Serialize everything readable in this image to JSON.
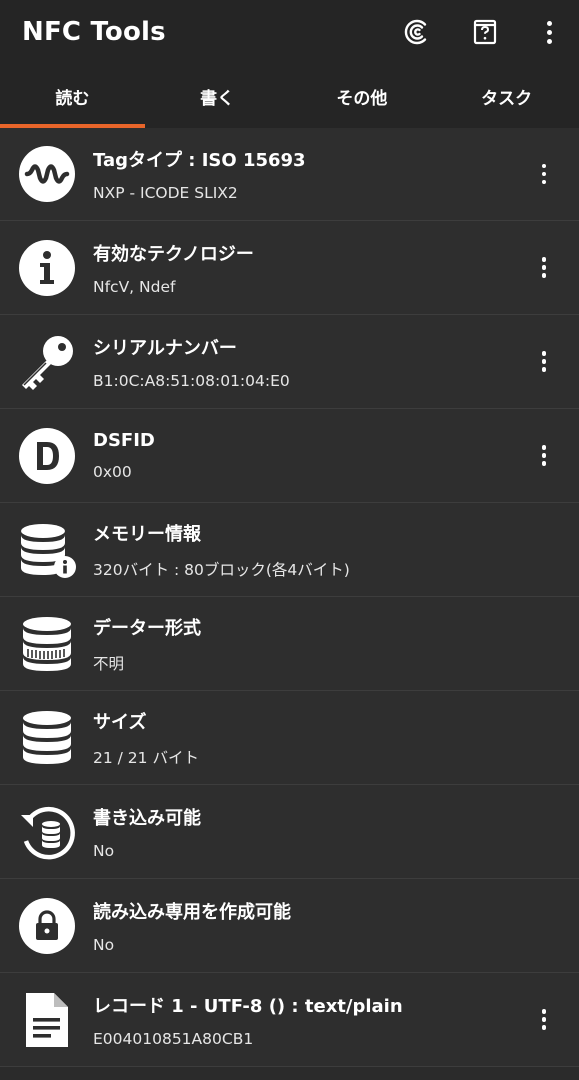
{
  "app": {
    "title": "NFC Tools"
  },
  "toolbar": {
    "icons": [
      "nfc-c-icon",
      "help-book-icon",
      "more-vert-icon"
    ]
  },
  "tabs": [
    {
      "label": "読む",
      "active": true
    },
    {
      "label": "書く",
      "active": false
    },
    {
      "label": "その他",
      "active": false
    },
    {
      "label": "タスク",
      "active": false
    }
  ],
  "colors": {
    "accent": "#e8652a",
    "background": "#2e2e2e",
    "appbar": "#252525"
  },
  "rows": [
    {
      "title": "Tagタイプ : ISO 15693",
      "subtitle": "NXP - ICODE SLIX2",
      "icon": "wave-icon",
      "has_menu": true
    },
    {
      "title": "有効なテクノロジー",
      "subtitle": "NfcV, Ndef",
      "icon": "info-icon",
      "has_menu": true
    },
    {
      "title": "シリアルナンバー",
      "subtitle": "B1:0C:A8:51:08:01:04:E0",
      "icon": "key-icon",
      "has_menu": true
    },
    {
      "title": "DSFID",
      "subtitle": "0x00",
      "icon": "d-letter-icon",
      "has_menu": true
    },
    {
      "title": "メモリー情報",
      "subtitle": "320バイト : 80ブロック(各4バイト)",
      "icon": "database-info-icon",
      "has_menu": false
    },
    {
      "title": "データー形式",
      "subtitle": "不明",
      "icon": "database-format-icon",
      "has_menu": false
    },
    {
      "title": "サイズ",
      "subtitle": "21 / 21 バイト",
      "icon": "database-icon",
      "has_menu": false
    },
    {
      "title": "書き込み可能",
      "subtitle": "No",
      "icon": "database-restore-icon",
      "has_menu": false
    },
    {
      "title": "読み込み専用を作成可能",
      "subtitle": "No",
      "icon": "lock-icon",
      "has_menu": false
    },
    {
      "title": "レコード 1 - UTF-8 () : text/plain",
      "subtitle": "E004010851A80CB1",
      "icon": "document-icon",
      "has_menu": true
    }
  ]
}
